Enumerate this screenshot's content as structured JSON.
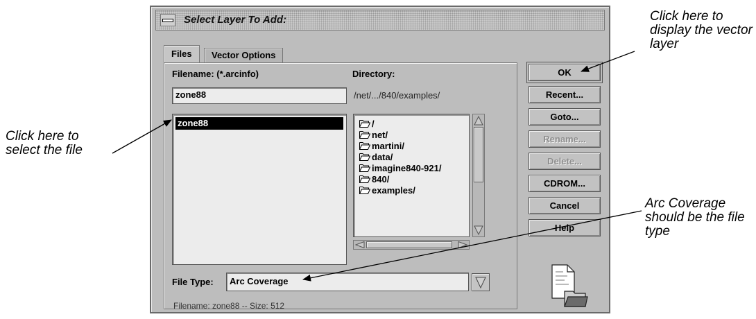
{
  "dialog": {
    "title": "Select Layer To Add:",
    "tabs": [
      {
        "label": "Files",
        "active": true
      },
      {
        "label": "Vector Options",
        "active": false
      }
    ],
    "filename_label": "Filename: (*.arcinfo)",
    "filename_value": "zone88",
    "file_list": [
      {
        "name": "zone88",
        "selected": true
      }
    ],
    "directory_label": "Directory:",
    "directory_path": "/net/.../840/examples/",
    "directory_items": [
      {
        "name": "/",
        "icon": "open-folder-icon"
      },
      {
        "name": "net/",
        "icon": "open-folder-icon"
      },
      {
        "name": "martini/",
        "icon": "open-folder-icon"
      },
      {
        "name": "data/",
        "icon": "open-folder-icon"
      },
      {
        "name": "imagine840-921/",
        "icon": "open-folder-icon"
      },
      {
        "name": "840/",
        "icon": "open-folder-icon"
      },
      {
        "name": "examples/",
        "icon": "open-folder-icon"
      }
    ],
    "file_type_label": "File Type:",
    "file_type_value": "Arc Coverage",
    "status": "Filename: zone88 -- Size: 512",
    "buttons": [
      {
        "label": "OK",
        "enabled": true
      },
      {
        "label": "Recent...",
        "enabled": true
      },
      {
        "label": "Goto...",
        "enabled": true
      },
      {
        "label": "Rename...",
        "enabled": false
      },
      {
        "label": "Delete...",
        "enabled": false
      },
      {
        "label": "CDROM...",
        "enabled": true
      },
      {
        "label": "Cancel",
        "enabled": true
      },
      {
        "label": "Help",
        "enabled": true
      }
    ]
  },
  "callouts": {
    "ok": "Click here to display the vector layer",
    "file": "Click here to select the file",
    "type": "Arc Coverage should be the file type"
  },
  "colors": {
    "dialog_bg": "#bdbdbd",
    "field_bg": "#ececec",
    "selection_bg": "#000000",
    "disabled_text": "#8f8f8f"
  }
}
